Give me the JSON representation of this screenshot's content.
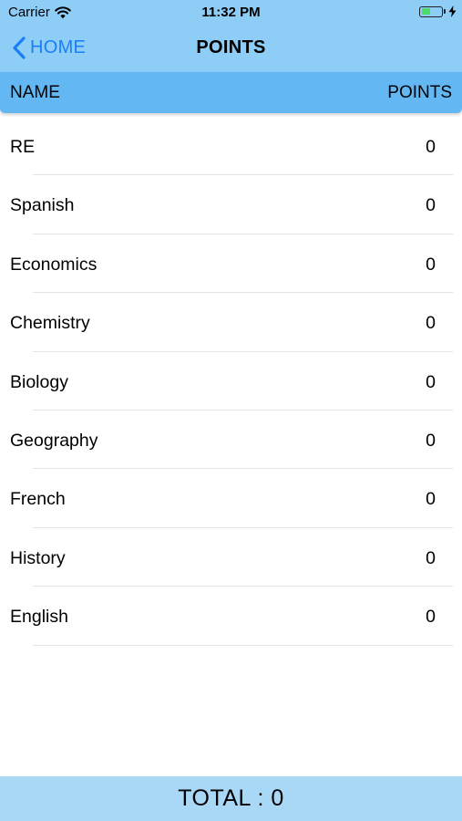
{
  "status_bar": {
    "carrier": "Carrier",
    "time": "11:32 PM",
    "battery_icon": "battery-charging-icon",
    "wifi_icon": "wifi-icon"
  },
  "nav": {
    "back_label": "HOME",
    "back_icon": "chevron-left-icon",
    "title": "POINTS"
  },
  "table": {
    "headers": {
      "name": "NAME",
      "points": "POINTS"
    },
    "rows": [
      {
        "name": "RE",
        "points": "0"
      },
      {
        "name": "Spanish",
        "points": "0"
      },
      {
        "name": "Economics",
        "points": "0"
      },
      {
        "name": "Chemistry",
        "points": "0"
      },
      {
        "name": "Biology",
        "points": "0"
      },
      {
        "name": "Geography",
        "points": "0"
      },
      {
        "name": "French",
        "points": "0"
      },
      {
        "name": "History",
        "points": "0"
      },
      {
        "name": "English",
        "points": "0"
      }
    ]
  },
  "footer": {
    "total": "TOTAL : 0"
  },
  "colors": {
    "nav_bg": "#8ecdf6",
    "header_bg": "#63b8f3",
    "footer_bg": "#a9d8f7",
    "accent": "#1a7ff5",
    "battery": "#4cd964"
  }
}
